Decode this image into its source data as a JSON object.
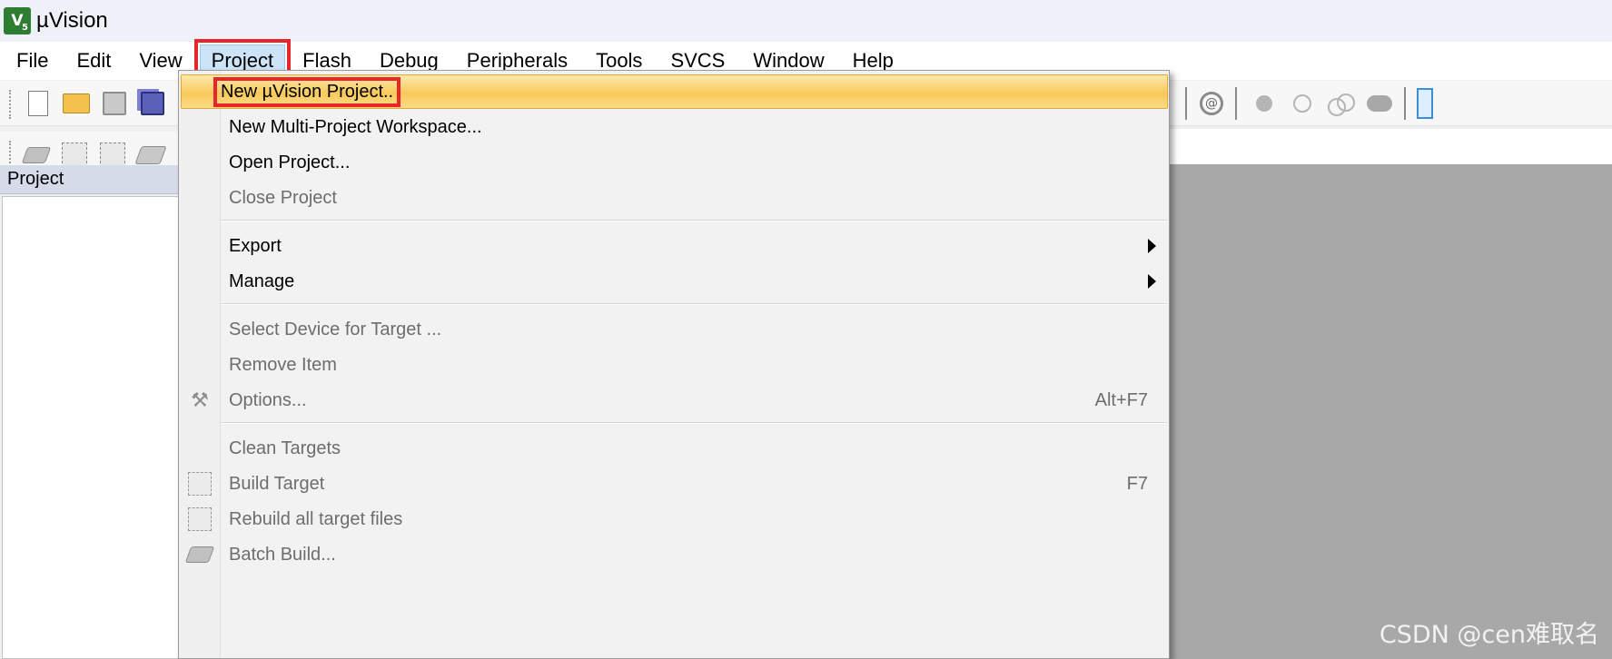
{
  "window": {
    "title": "µVision",
    "logo_text": "V",
    "logo_sub": "5"
  },
  "menubar": {
    "items": [
      "File",
      "Edit",
      "View",
      "Project",
      "Flash",
      "Debug",
      "Peripherals",
      "Tools",
      "SVCS",
      "Window",
      "Help"
    ],
    "active": "Project"
  },
  "toolbar1": {
    "icons": [
      "new-file-icon",
      "open-folder-icon",
      "save-icon",
      "save-all-icon",
      "find-icon",
      "breakpoint-icon",
      "disabled-breakpoint-icon",
      "kill-breakpoints-icon",
      "config-icon",
      "window-icon"
    ]
  },
  "toolbar2": {
    "icons": [
      "translate-icon",
      "build-icon",
      "rebuild-icon",
      "batch-build-icon"
    ]
  },
  "project_panel": {
    "title": "Project"
  },
  "project_menu": {
    "items": [
      {
        "label": "New µVision Project..",
        "highlighted": true,
        "disabled": false
      },
      {
        "label": "New Multi-Project Workspace...",
        "disabled": false
      },
      {
        "label": "Open Project...",
        "disabled": false
      },
      {
        "label": "Close Project",
        "disabled": true
      },
      {
        "label": "Export",
        "submenu": true,
        "disabled": false
      },
      {
        "label": "Manage",
        "submenu": true,
        "disabled": false
      },
      {
        "label": "Select Device for Target ...",
        "disabled": true
      },
      {
        "label": "Remove Item",
        "disabled": true
      },
      {
        "label": "Options...",
        "shortcut": "Alt+F7",
        "icon": "options-wand-icon",
        "disabled": true
      },
      {
        "label": "Clean Targets",
        "disabled": true
      },
      {
        "label": "Build Target",
        "shortcut": "F7",
        "icon": "build-icon",
        "disabled": true
      },
      {
        "label": "Rebuild all target files",
        "icon": "rebuild-icon",
        "disabled": true
      },
      {
        "label": "Batch Build...",
        "icon": "batch-build-icon",
        "disabled": true
      }
    ]
  },
  "watermark": "CSDN @cen难取名",
  "colors": {
    "highlight_outline": "#e8252a",
    "menu_highlight": "#f9c95a",
    "editor_background": "#a8a8a8"
  }
}
